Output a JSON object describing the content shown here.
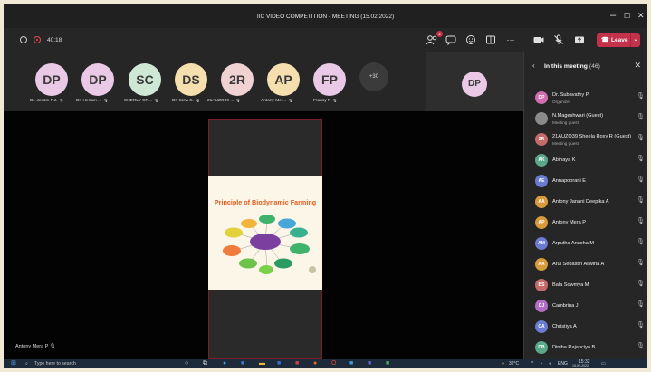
{
  "window": {
    "title": "IIC VIDEO COMPETITION - MEETING (15.02.2022)",
    "minimize": "–",
    "maximize": "☐",
    "close": "✕"
  },
  "meeting_header": {
    "timer": "40:18",
    "participants_badge": "2",
    "leave_label": "Leave",
    "leave_icon": "phone-hangup-icon",
    "icons": [
      "participants-icon",
      "chat-icon",
      "reactions-icon",
      "rooms-icon",
      "more-icon",
      "camera-icon",
      "mic-off-icon",
      "share-icon"
    ]
  },
  "strip": {
    "avatars": [
      {
        "initials": "DP",
        "name": "Dr. Jesdin P.J.",
        "color": "#e9c9e6"
      },
      {
        "initials": "DP",
        "name": "Dr. Hermin ...",
        "color": "#e9c9e6"
      },
      {
        "initials": "SC",
        "name": "SHERLY CR...",
        "color": "#cfe8d6"
      },
      {
        "initials": "DS",
        "name": "Dr. Selvi S.",
        "color": "#f6dfae"
      },
      {
        "initials": "2R",
        "name": "21AUZO39 ...",
        "color": "#f1d2d2"
      },
      {
        "initials": "AP",
        "name": "Antony Mer...",
        "color": "#f6dfae"
      },
      {
        "initials": "FP",
        "name": "Fransy P",
        "color": "#e9c9e6"
      }
    ],
    "more_count": "+30",
    "self_initials": "DP"
  },
  "stage": {
    "slide_title": "Principle of Biodynamic Farming",
    "pinned_name": "Antony Mera P"
  },
  "panel": {
    "title": "In this meeting",
    "count": "(46)",
    "participants": [
      {
        "initials": "DP",
        "name": "Dr. Subavathy P.",
        "role": "Organizer",
        "color": "#d16db0"
      },
      {
        "initials": "",
        "name": "N.Mageshwari (Guest)",
        "role": "Meeting guest",
        "color": "#8a8a8a"
      },
      {
        "initials": "2R",
        "name": "21AUZO39 Sheela Roxy R (Guest)",
        "role": "Meeting guest",
        "color": "#c46a6a"
      },
      {
        "initials": "AK",
        "name": "Abinaya K",
        "role": "",
        "color": "#5aa78a"
      },
      {
        "initials": "AE",
        "name": "Annapoorani E",
        "role": "",
        "color": "#6b7bd1"
      },
      {
        "initials": "AA",
        "name": "Antony Janani Deepika A",
        "role": "",
        "color": "#d99a3b"
      },
      {
        "initials": "AP",
        "name": "Antony Mera P",
        "role": "",
        "color": "#d99a3b"
      },
      {
        "initials": "AM",
        "name": "Arputha Anusha M",
        "role": "",
        "color": "#6b7bd1"
      },
      {
        "initials": "AA",
        "name": "Arul Sebastin Allwina A",
        "role": "",
        "color": "#d99a3b"
      },
      {
        "initials": "BS",
        "name": "Bala Sowmya M",
        "role": "",
        "color": "#c46a6a"
      },
      {
        "initials": "CJ",
        "name": "Cambrina J",
        "role": "",
        "color": "#b06ec4"
      },
      {
        "initials": "CA",
        "name": "Christiya A",
        "role": "",
        "color": "#6b7bd1"
      },
      {
        "initials": "DB",
        "name": "Diniba Rajanciya B",
        "role": "",
        "color": "#5aa78a"
      }
    ]
  },
  "taskbar": {
    "search_placeholder": "Type here to search",
    "temperature": "32°C",
    "language": "ENG",
    "time": "15:32",
    "date": "15-02-2022"
  }
}
